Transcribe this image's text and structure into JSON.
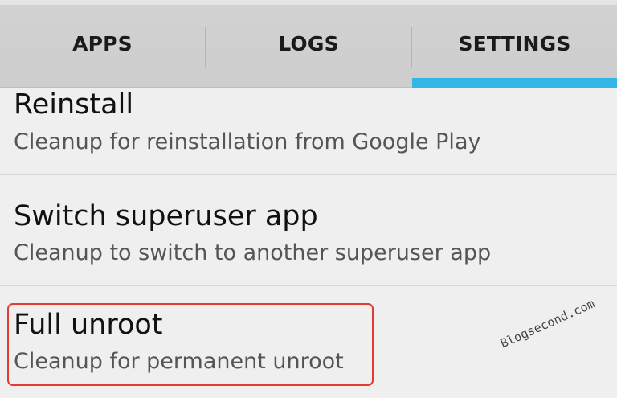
{
  "tabs": {
    "apps": "APPS",
    "logs": "LOGS",
    "settings": "SETTINGS",
    "active": "SETTINGS",
    "indicator_color": "#33b5e5"
  },
  "items": [
    {
      "title": "Reinstall",
      "summary": "Cleanup for reinstallation from Google Play"
    },
    {
      "title": "Switch superuser app",
      "summary": "Cleanup to switch to another superuser app"
    },
    {
      "title": "Full unroot",
      "summary": "Cleanup for permanent unroot"
    }
  ],
  "highlight_color": "#e53935",
  "watermark": "Blogsecond.com"
}
